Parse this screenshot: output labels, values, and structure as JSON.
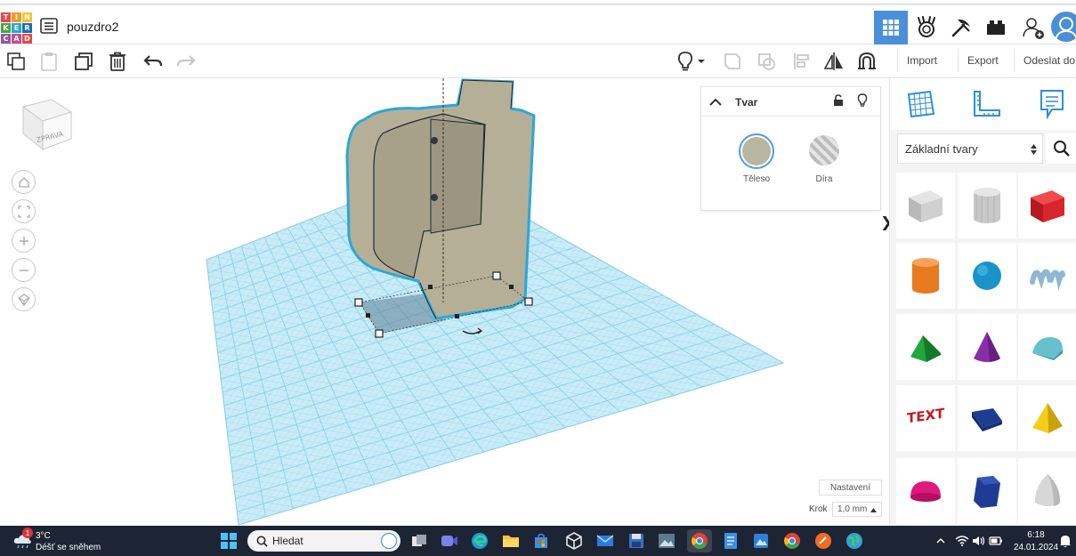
{
  "app": {
    "logo_letters": [
      "T",
      "I",
      "N",
      "K",
      "E",
      "R",
      "C",
      "A",
      "D"
    ],
    "logo_colors": [
      "#e8494b",
      "#f29b2a",
      "#f6c231",
      "#47a742",
      "#27a7d9",
      "#1d6db3",
      "#8d5ba6",
      "#c94b8b",
      "#e8494b"
    ],
    "document_title": "pouzdro2"
  },
  "header": {
    "views": [
      "3d-design-view-icon",
      "sim-lab-icon",
      "build-icon",
      "bricks-icon"
    ],
    "active_view": "3d-design-view-icon"
  },
  "toolbar": {
    "import_label": "Import",
    "export_label": "Export",
    "send_label": "Odeslat do"
  },
  "viewcube": {
    "face_label": "ZPRAVA"
  },
  "shape_panel": {
    "title": "Tvar",
    "solid_label": "Těleso",
    "hole_label": "Díra",
    "solid_color": "#b8b6a0"
  },
  "workplane": {
    "settings_label": "Nastavení",
    "step_label": "Krok",
    "step_value": "1,0 mm",
    "grid_color": "#9fd8ee"
  },
  "library": {
    "selected": "Základní tvary"
  },
  "taskbar": {
    "weather_temp": "3°C",
    "weather_desc": "Déšť se sněhem",
    "weather_badge": "1",
    "search_placeholder": "Hledat",
    "time": "6:18",
    "date": "24.01.2024"
  }
}
